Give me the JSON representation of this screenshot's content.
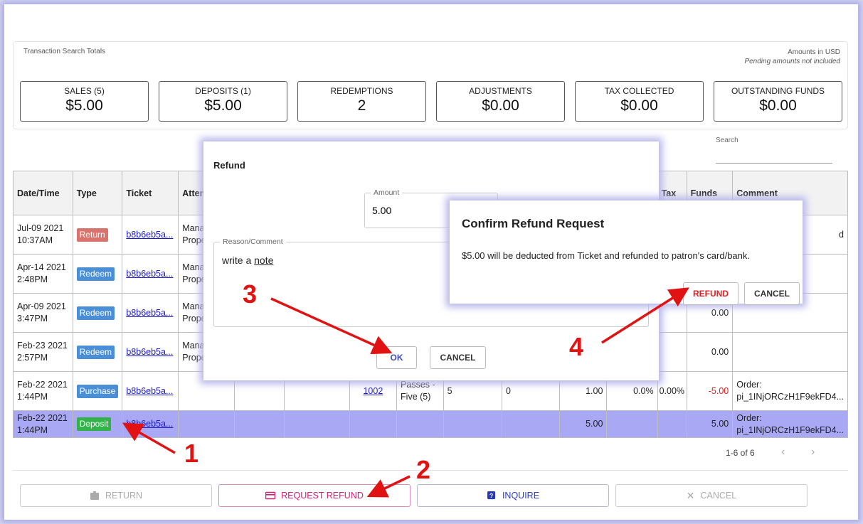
{
  "totals": {
    "title": "Transaction Search Totals",
    "amounts_note": "Amounts in USD",
    "pending_note": "Pending amounts not included",
    "boxes": [
      {
        "label": "SALES (5)",
        "value": "$5.00"
      },
      {
        "label": "DEPOSITS (1)",
        "value": "$5.00"
      },
      {
        "label": "REDEMPTIONS",
        "value": "2"
      },
      {
        "label": "ADJUSTMENTS",
        "value": "$0.00"
      },
      {
        "label": "TAX COLLECTED",
        "value": "$0.00"
      },
      {
        "label": "OUTSTANDING FUNDS",
        "value": "$0.00"
      }
    ]
  },
  "search": {
    "label": "Search"
  },
  "table": {
    "headers": [
      "Date/Time",
      "Type",
      "Ticket",
      "Attendee",
      "",
      "",
      "",
      "",
      "",
      "",
      "",
      "",
      "Tax",
      "Funds",
      "Comment"
    ],
    "headers_visible": {
      "date": "Date/Time",
      "type": "Type",
      "ticket": "Ticket",
      "attendee": "Atten",
      "tax": "Tax",
      "funds": "Funds",
      "comment": "Comment"
    },
    "rows": [
      {
        "date": "Jul-09 2021",
        "time": "10:37AM",
        "type": "Return",
        "ticket": "b8b6eb5a...",
        "attendee": "Manag",
        "attendee2": "Proper",
        "c4": "",
        "c5": "",
        "c6": "",
        "c7": "",
        "c8": "",
        "c9": "",
        "c10": "",
        "c11": "",
        "c12": "",
        "tax": "",
        "funds": "",
        "comment": "d"
      },
      {
        "date": "Apr-14 2021",
        "time": "2:48PM",
        "type": "Redeem",
        "ticket": "b8b6eb5a...",
        "attendee": "Manag",
        "attendee2": "Proper",
        "c4": "",
        "c5": "",
        "c6": "",
        "c7": "",
        "c8": "",
        "c9": "",
        "c10": "",
        "c11": "",
        "c12": "",
        "tax": "",
        "funds": "",
        "comment": ""
      },
      {
        "date": "Apr-09 2021",
        "time": "3:47PM",
        "type": "Redeem",
        "ticket": "b8b6eb5a...",
        "attendee": "Manag",
        "attendee2": "Proper",
        "c4": "",
        "c5": "",
        "c6": "",
        "c7": "",
        "c8": "",
        "c9": "",
        "c10": "",
        "c11": "",
        "c12": "",
        "tax": "",
        "funds": "0.00",
        "comment": ""
      },
      {
        "date": "Feb-23 2021",
        "time": "2:57PM",
        "type": "Redeem",
        "ticket": "b8b6eb5a...",
        "attendee": "Manag",
        "attendee2": "Proper",
        "c4": "",
        "c5": "",
        "c6": "",
        "c7": "",
        "c8": "",
        "c9": "",
        "c10": "",
        "c11": "",
        "c12": "",
        "tax": "",
        "funds": "0.00",
        "comment": ""
      },
      {
        "date": "Feb-22 2021",
        "time": "1:44PM",
        "type": "Purchase",
        "ticket": "b8b6eb5a...",
        "attendee": "",
        "attendee2": "",
        "c4": "",
        "c5": "1002",
        "c6": "Passes -",
        "c6b": "Five (5)",
        "c7": "5",
        "c8": "0",
        "c9": "1.00",
        "c10": "0.0%",
        "c11": "0.00%",
        "tax": "",
        "funds": "-5.00",
        "comment": "Order:",
        "comment2": "pi_1INjORCzH1F9ekFD4..."
      },
      {
        "date": "Feb-22 2021",
        "time": "1:44PM",
        "type": "Deposit",
        "ticket": "b8b6eb5a...",
        "attendee": "",
        "attendee2": "",
        "c4": "",
        "c5": "",
        "c6": "",
        "c6b": "",
        "c7": "",
        "c8": "",
        "c9": "5.00",
        "c10": "",
        "c11": "",
        "tax": "",
        "funds": "5.00",
        "comment": "Order:",
        "comment2": "pi_1INjORCzH1F9ekFD4..."
      }
    ]
  },
  "pagination": {
    "text": "1-6 of 6"
  },
  "actions": {
    "return": "RETURN",
    "request_refund": "REQUEST REFUND",
    "inquire": "INQUIRE",
    "cancel": "CANCEL"
  },
  "refund_dialog": {
    "title": "Refund",
    "amount_label": "Amount",
    "amount_value": "5.00",
    "reason_label": "Reason/Comment",
    "reason_value_prefix": "write a ",
    "reason_value_word": "note",
    "ok": "OK",
    "cancel": "CANCEL"
  },
  "confirm_dialog": {
    "title": "Confirm Refund Request",
    "message": "$5.00 will be deducted from Ticket and refunded to patron's card/bank.",
    "refund": "REFUND",
    "cancel": "CANCEL"
  },
  "annotations": {
    "n1": "1",
    "n2": "2",
    "n3": "3",
    "n4": "4"
  },
  "colors": {
    "selected_row": "#a8a8f4",
    "annotation": "#e11212",
    "refund_accent": "#d01e78"
  }
}
